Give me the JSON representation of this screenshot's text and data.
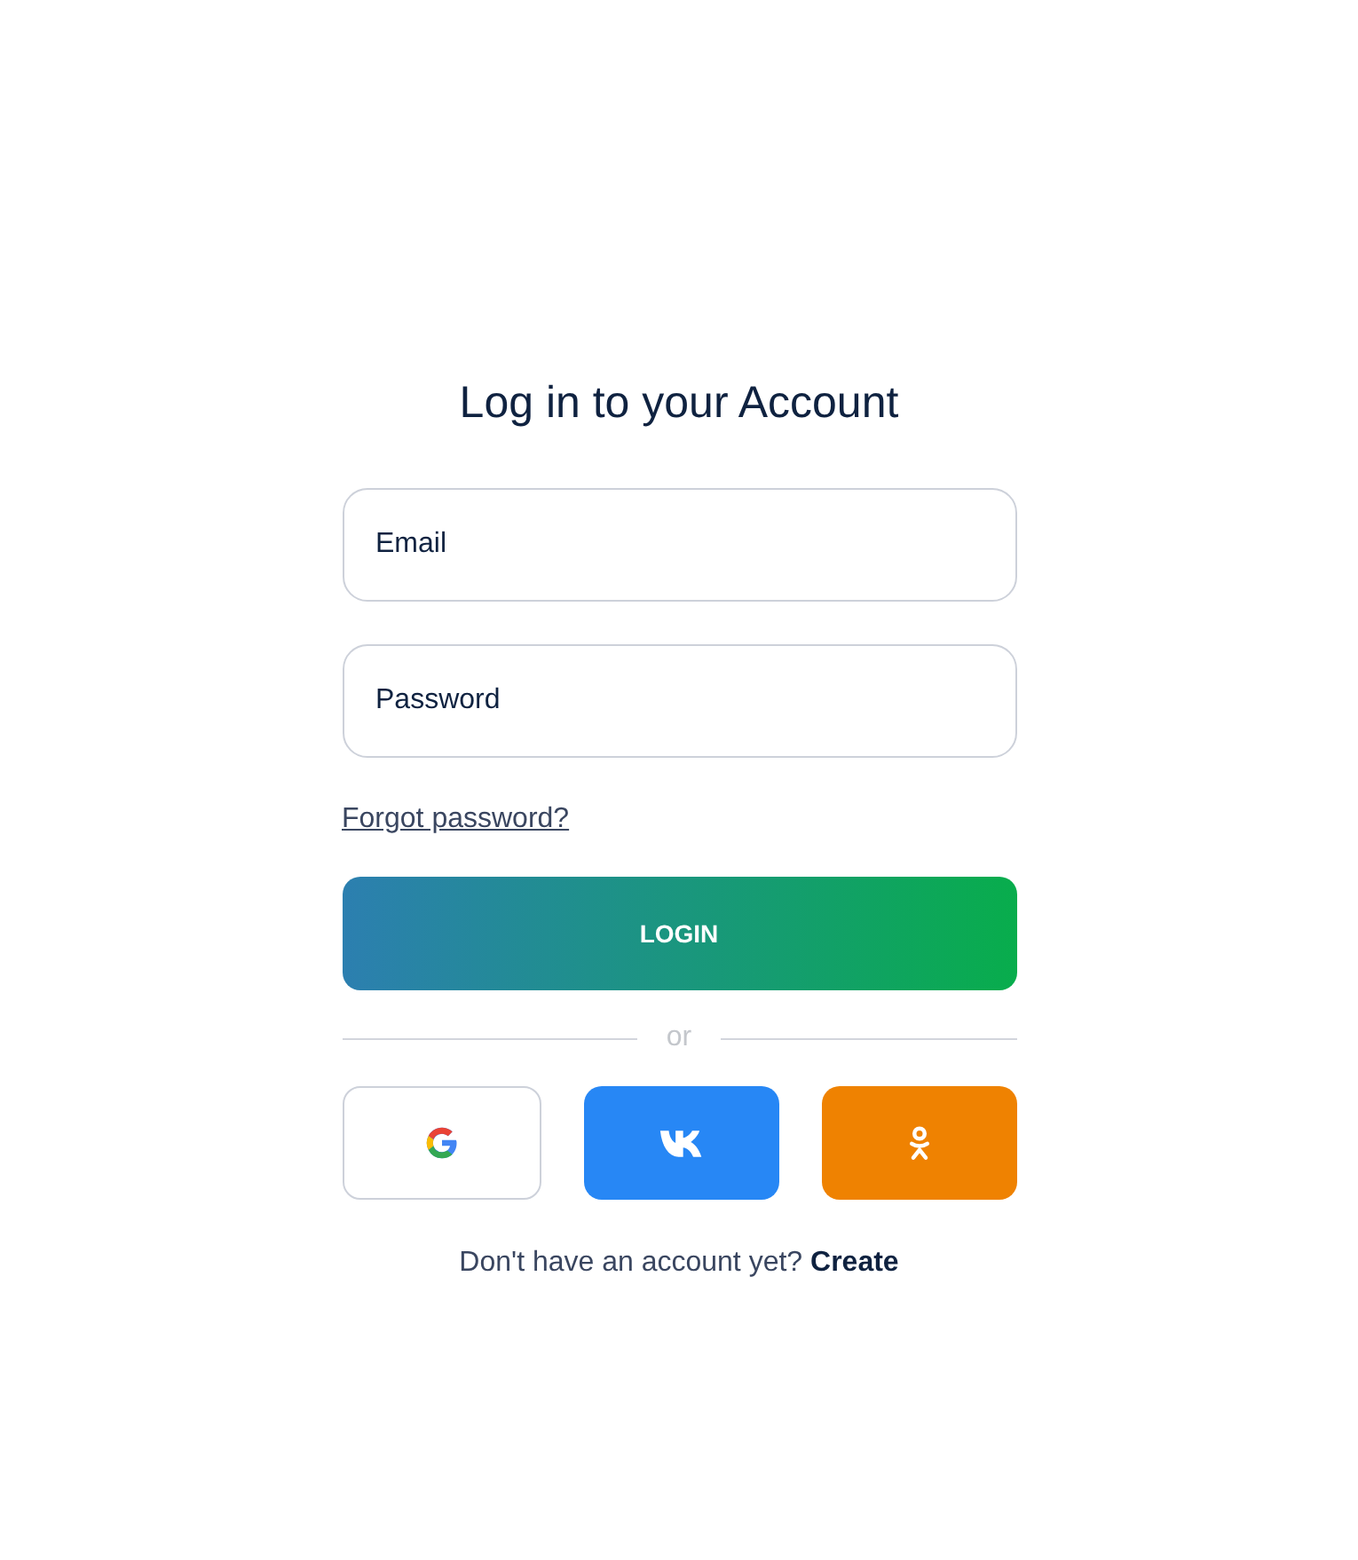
{
  "title": "Log in to your Account",
  "fields": [
    {
      "placeholder": "Email"
    },
    {
      "placeholder": "Password"
    }
  ],
  "forgot_link": "Forgot password?",
  "login_button": "LOGIN",
  "divider": "or",
  "social_buttons": [
    {
      "kind": "google"
    },
    {
      "kind": "vk"
    },
    {
      "kind": "ok"
    }
  ],
  "signup": {
    "prompt": "Don't have an account yet?",
    "link": "Create"
  }
}
